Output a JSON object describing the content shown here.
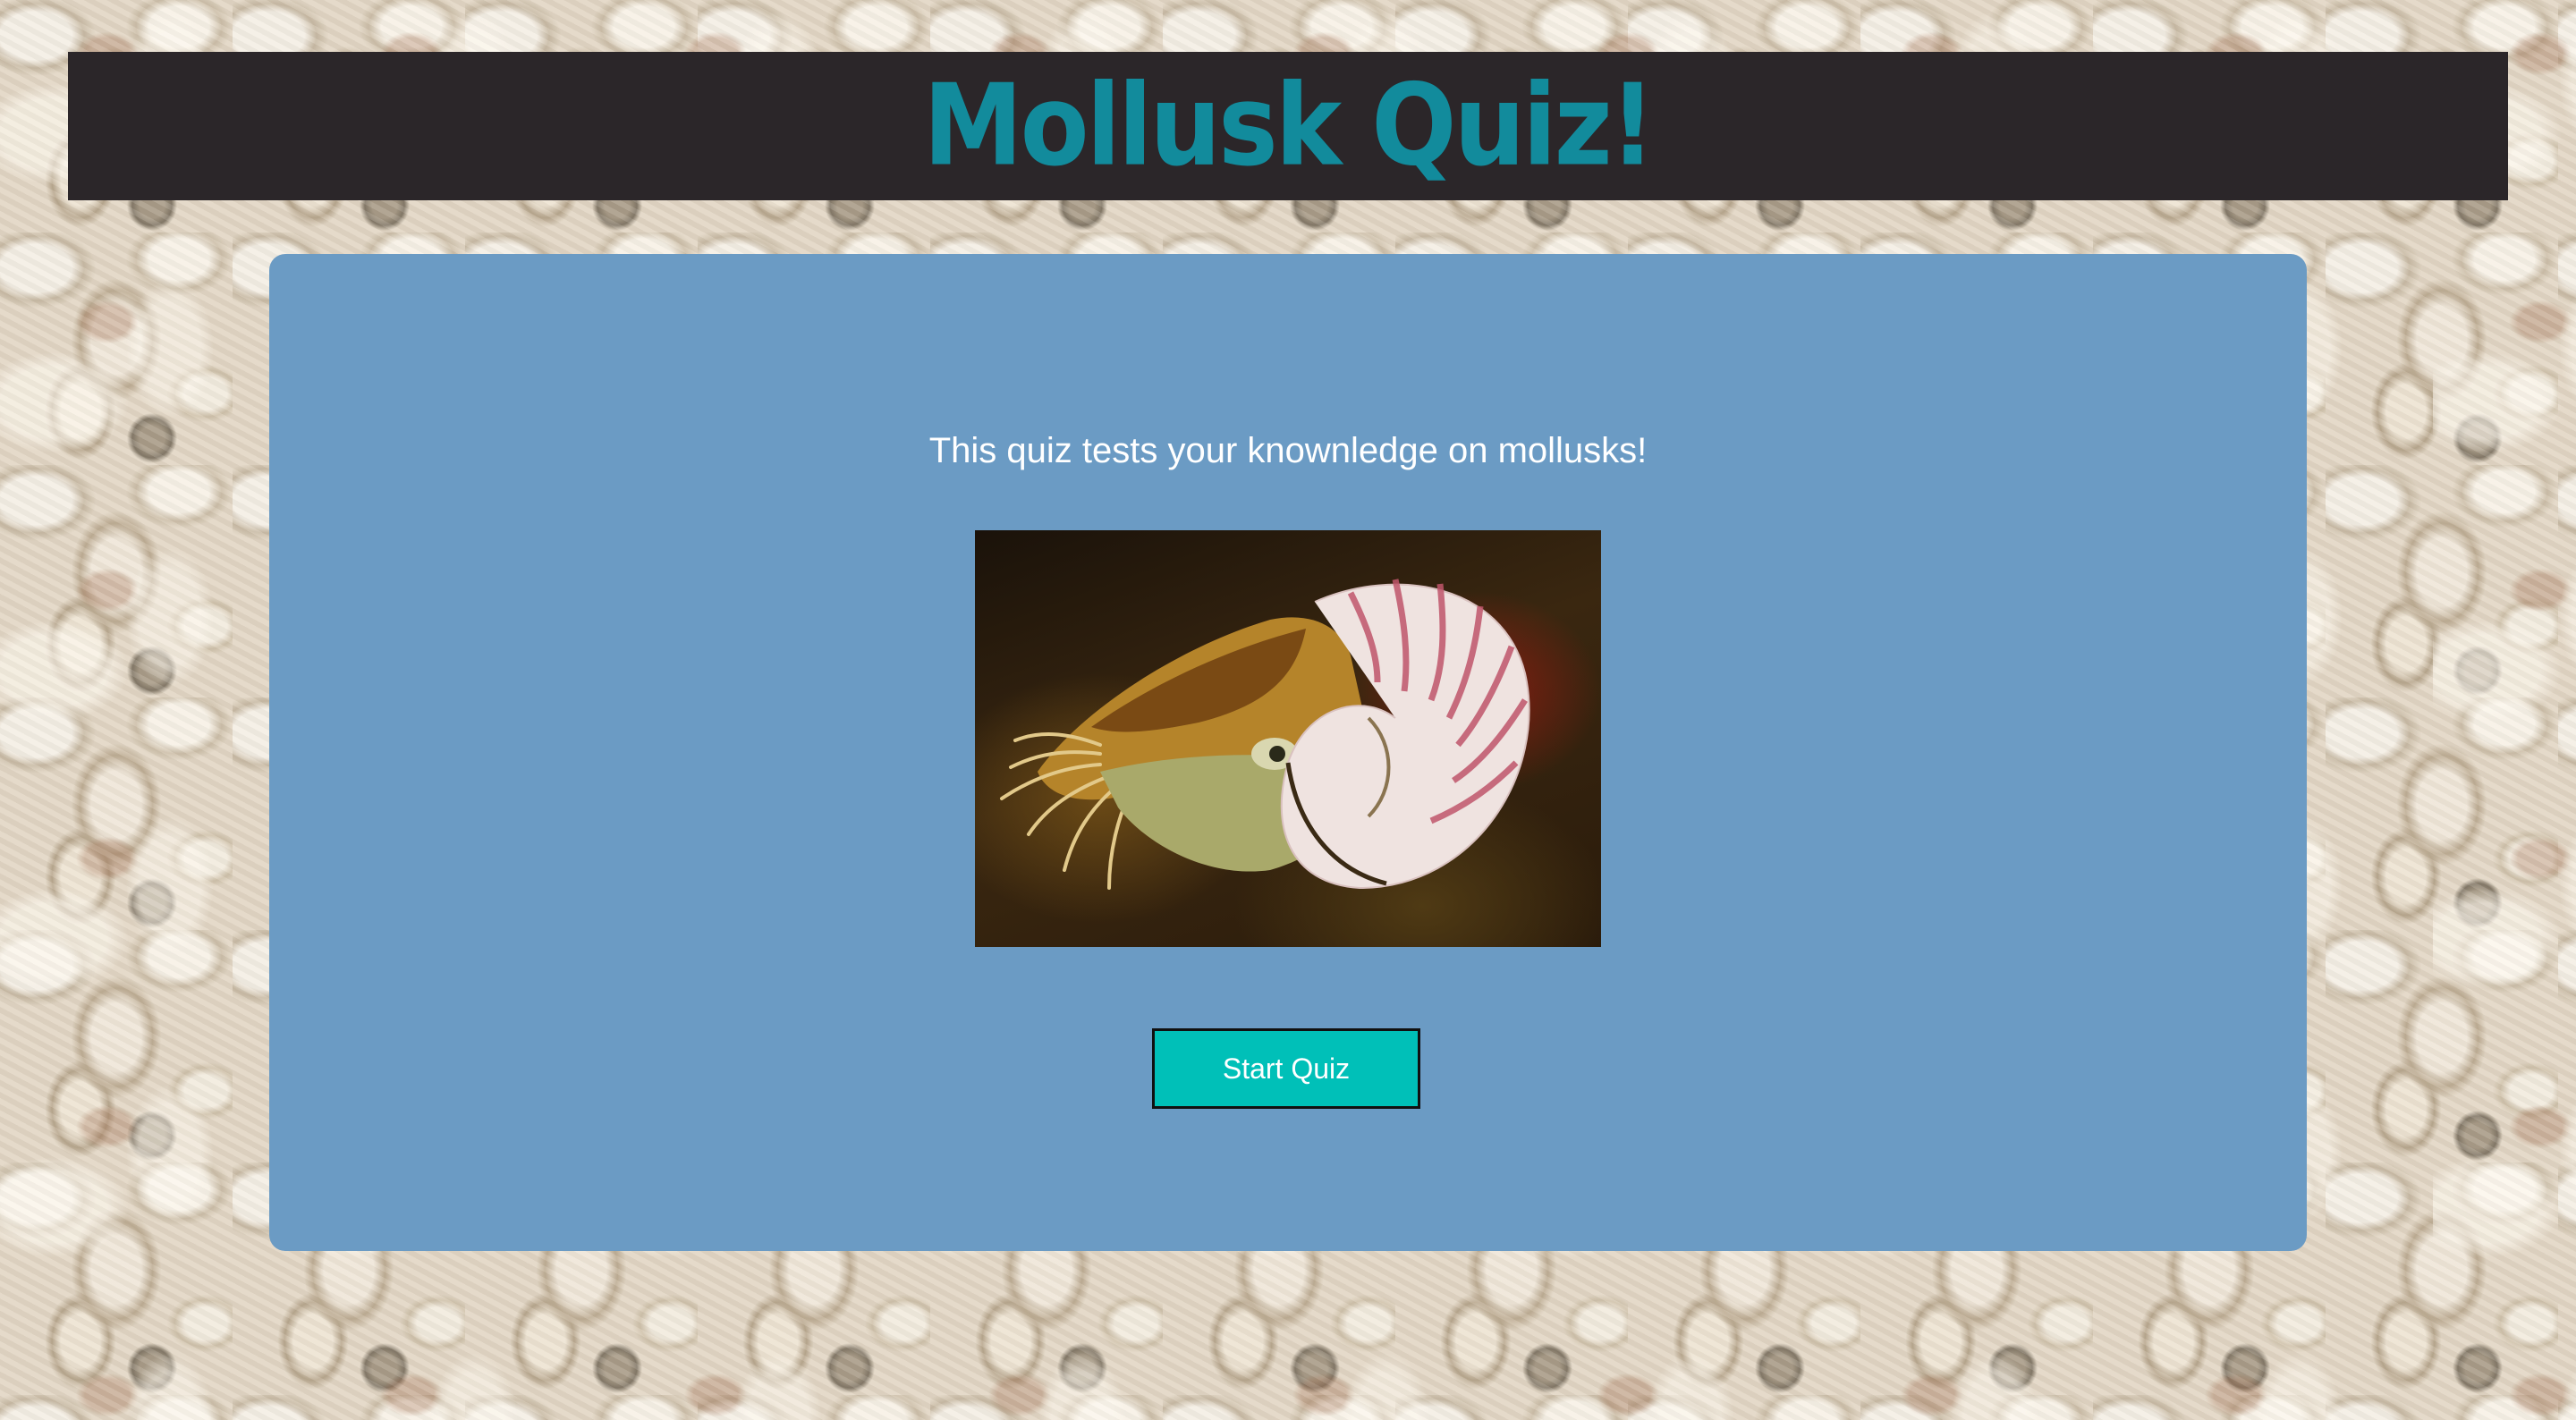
{
  "page": {
    "background_icon": "seashells-background"
  },
  "header": {
    "title": "Mollusk Quiz!",
    "title_color": "#128b9c",
    "background_color": "#2b2629"
  },
  "card": {
    "background_color": "#6b9bc4",
    "intro_text": "This quiz tests your knownledge on mollusks!",
    "image": {
      "subject": "nautilus-photo"
    },
    "start_button": {
      "label": "Start Quiz",
      "color": "#00c0b8"
    }
  }
}
